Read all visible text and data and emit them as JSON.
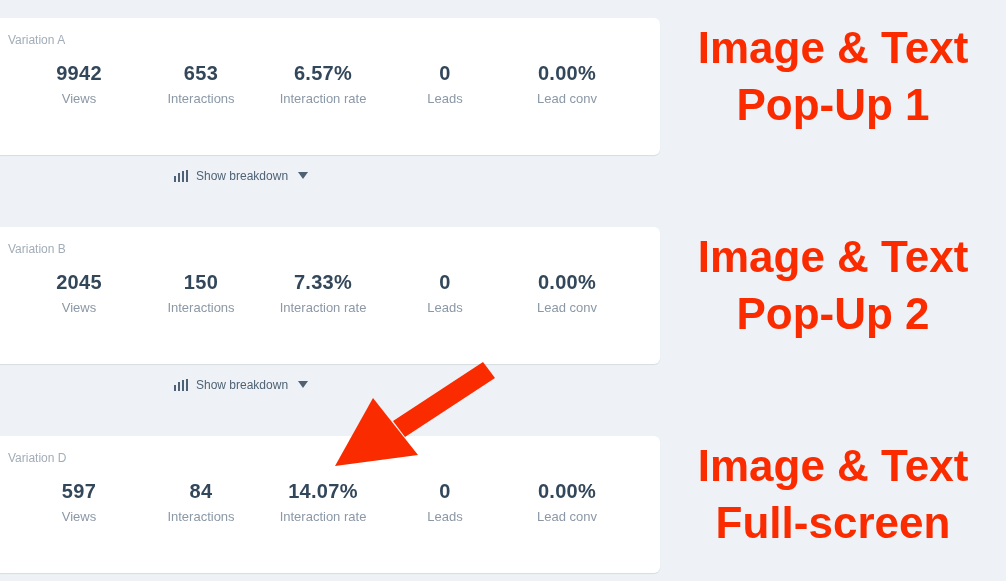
{
  "variations": [
    {
      "name": "Variation A",
      "stats": [
        {
          "value": "9942",
          "label": "Views"
        },
        {
          "value": "653",
          "label": "Interactions"
        },
        {
          "value": "6.57%",
          "label": "Interaction rate"
        },
        {
          "value": "0",
          "label": "Leads"
        },
        {
          "value": "0.00%",
          "label": "Lead conv"
        }
      ],
      "breakdown": "Show breakdown",
      "annotation": [
        "Image & Text",
        "Pop-Up 1"
      ]
    },
    {
      "name": "Variation B",
      "stats": [
        {
          "value": "2045",
          "label": "Views"
        },
        {
          "value": "150",
          "label": "Interactions"
        },
        {
          "value": "7.33%",
          "label": "Interaction rate"
        },
        {
          "value": "0",
          "label": "Leads"
        },
        {
          "value": "0.00%",
          "label": "Lead conv"
        }
      ],
      "breakdown": "Show breakdown",
      "annotation": [
        "Image & Text",
        "Pop-Up 2"
      ]
    },
    {
      "name": "Variation D",
      "stats": [
        {
          "value": "597",
          "label": "Views"
        },
        {
          "value": "84",
          "label": "Interactions"
        },
        {
          "value": "14.07%",
          "label": "Interaction rate"
        },
        {
          "value": "0",
          "label": "Leads"
        },
        {
          "value": "0.00%",
          "label": "Lead conv"
        }
      ],
      "annotation": [
        "Image & Text",
        "Full-screen"
      ]
    }
  ]
}
